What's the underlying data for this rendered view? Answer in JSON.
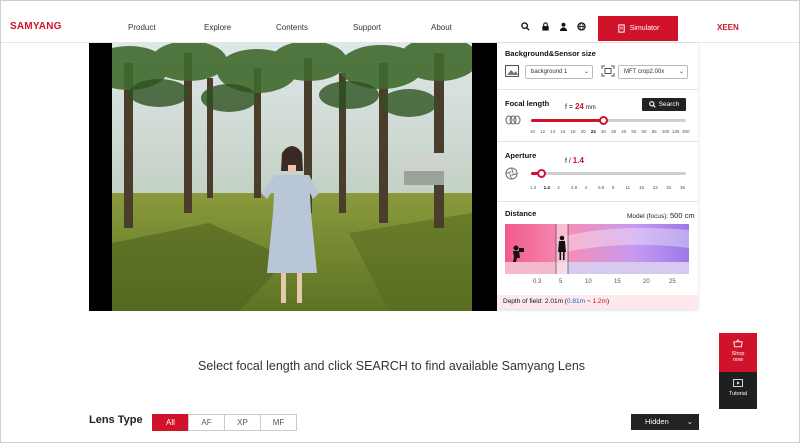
{
  "header": {
    "logo": "SAMYANG",
    "nav": [
      "Product",
      "Explore",
      "Contents",
      "Support",
      "About"
    ],
    "icons": [
      "search-icon",
      "lock-icon",
      "user-icon",
      "globe-icon"
    ],
    "simulator_label": "Simulator",
    "xeen_label": "XEEN",
    "accent": "#d0132b"
  },
  "panel": {
    "background_sensor": {
      "title": "Background&Sensor size",
      "background_value": "background 1",
      "sensor_value": "MFT crop2.00x"
    },
    "focal": {
      "title": "Focal length",
      "readout_prefix": "f =",
      "value": "24",
      "unit": "mm",
      "search_label": "Search",
      "ticks": [
        "10",
        "12",
        "14",
        "16",
        "18",
        "20",
        "24",
        "30",
        "35",
        "40",
        "50",
        "60",
        "85",
        "100",
        "135",
        "300"
      ],
      "selected_tick": "24"
    },
    "aperture": {
      "title": "Aperture",
      "readout_prefix": "f /",
      "value": "1.4",
      "ticks": [
        "1.2",
        "1.4",
        "2",
        "2.8",
        "4",
        "5.6",
        "8",
        "11",
        "16",
        "22",
        "32",
        "36"
      ],
      "selected_tick": "1.4"
    },
    "distance": {
      "title": "Distance",
      "model_label": "Model (focus):",
      "model_value": "500 cm",
      "ticks": [
        "0.3",
        "5",
        "10",
        "15",
        "20",
        "25"
      ]
    },
    "dof": {
      "label": "Depth of field:",
      "value": "2.01m",
      "near": "0.81m",
      "sep": "~",
      "far": "1.2m"
    }
  },
  "body": {
    "instruction": "Select focal length and click SEARCH to find available Samyang Lens",
    "lens_type_label": "Lens Type",
    "tabs": [
      "All",
      "AF",
      "XP",
      "MF"
    ],
    "active_tab": "All",
    "hidden_label": "Hidden"
  },
  "side": {
    "shop_label": "Shop now",
    "tutorial_label": "Tutorial"
  }
}
